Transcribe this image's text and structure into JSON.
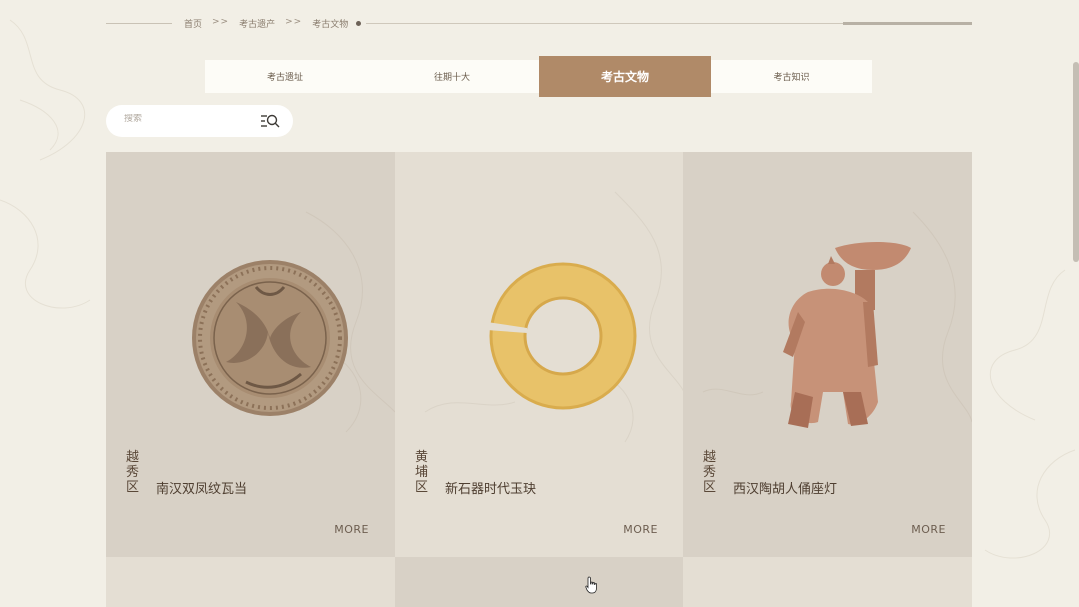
{
  "breadcrumb": {
    "home": "首页",
    "sep1": ">>",
    "level2": "考古遗产",
    "sep2": ">>",
    "current": "考古文物"
  },
  "tabs": [
    {
      "label": "考古遗址",
      "active": false
    },
    {
      "label": "往期十大",
      "active": false
    },
    {
      "label": "考古文物",
      "active": true
    },
    {
      "label": "考古知识",
      "active": false
    }
  ],
  "search": {
    "placeholder": "搜索",
    "icon": "search-list-icon"
  },
  "cards": [
    {
      "district": "越秀区",
      "title": "南汉双凤纹瓦当",
      "more": "MORE"
    },
    {
      "district": "黄埔区",
      "title": "新石器时代玉玦",
      "more": "MORE"
    },
    {
      "district": "越秀区",
      "title": "西汉陶胡人俑座灯",
      "more": "MORE"
    }
  ],
  "colors": {
    "background": "#f2efe6",
    "active_tab": "#b08a68",
    "card_dark": "#d8d1c6",
    "card_light": "#e4ded3"
  }
}
